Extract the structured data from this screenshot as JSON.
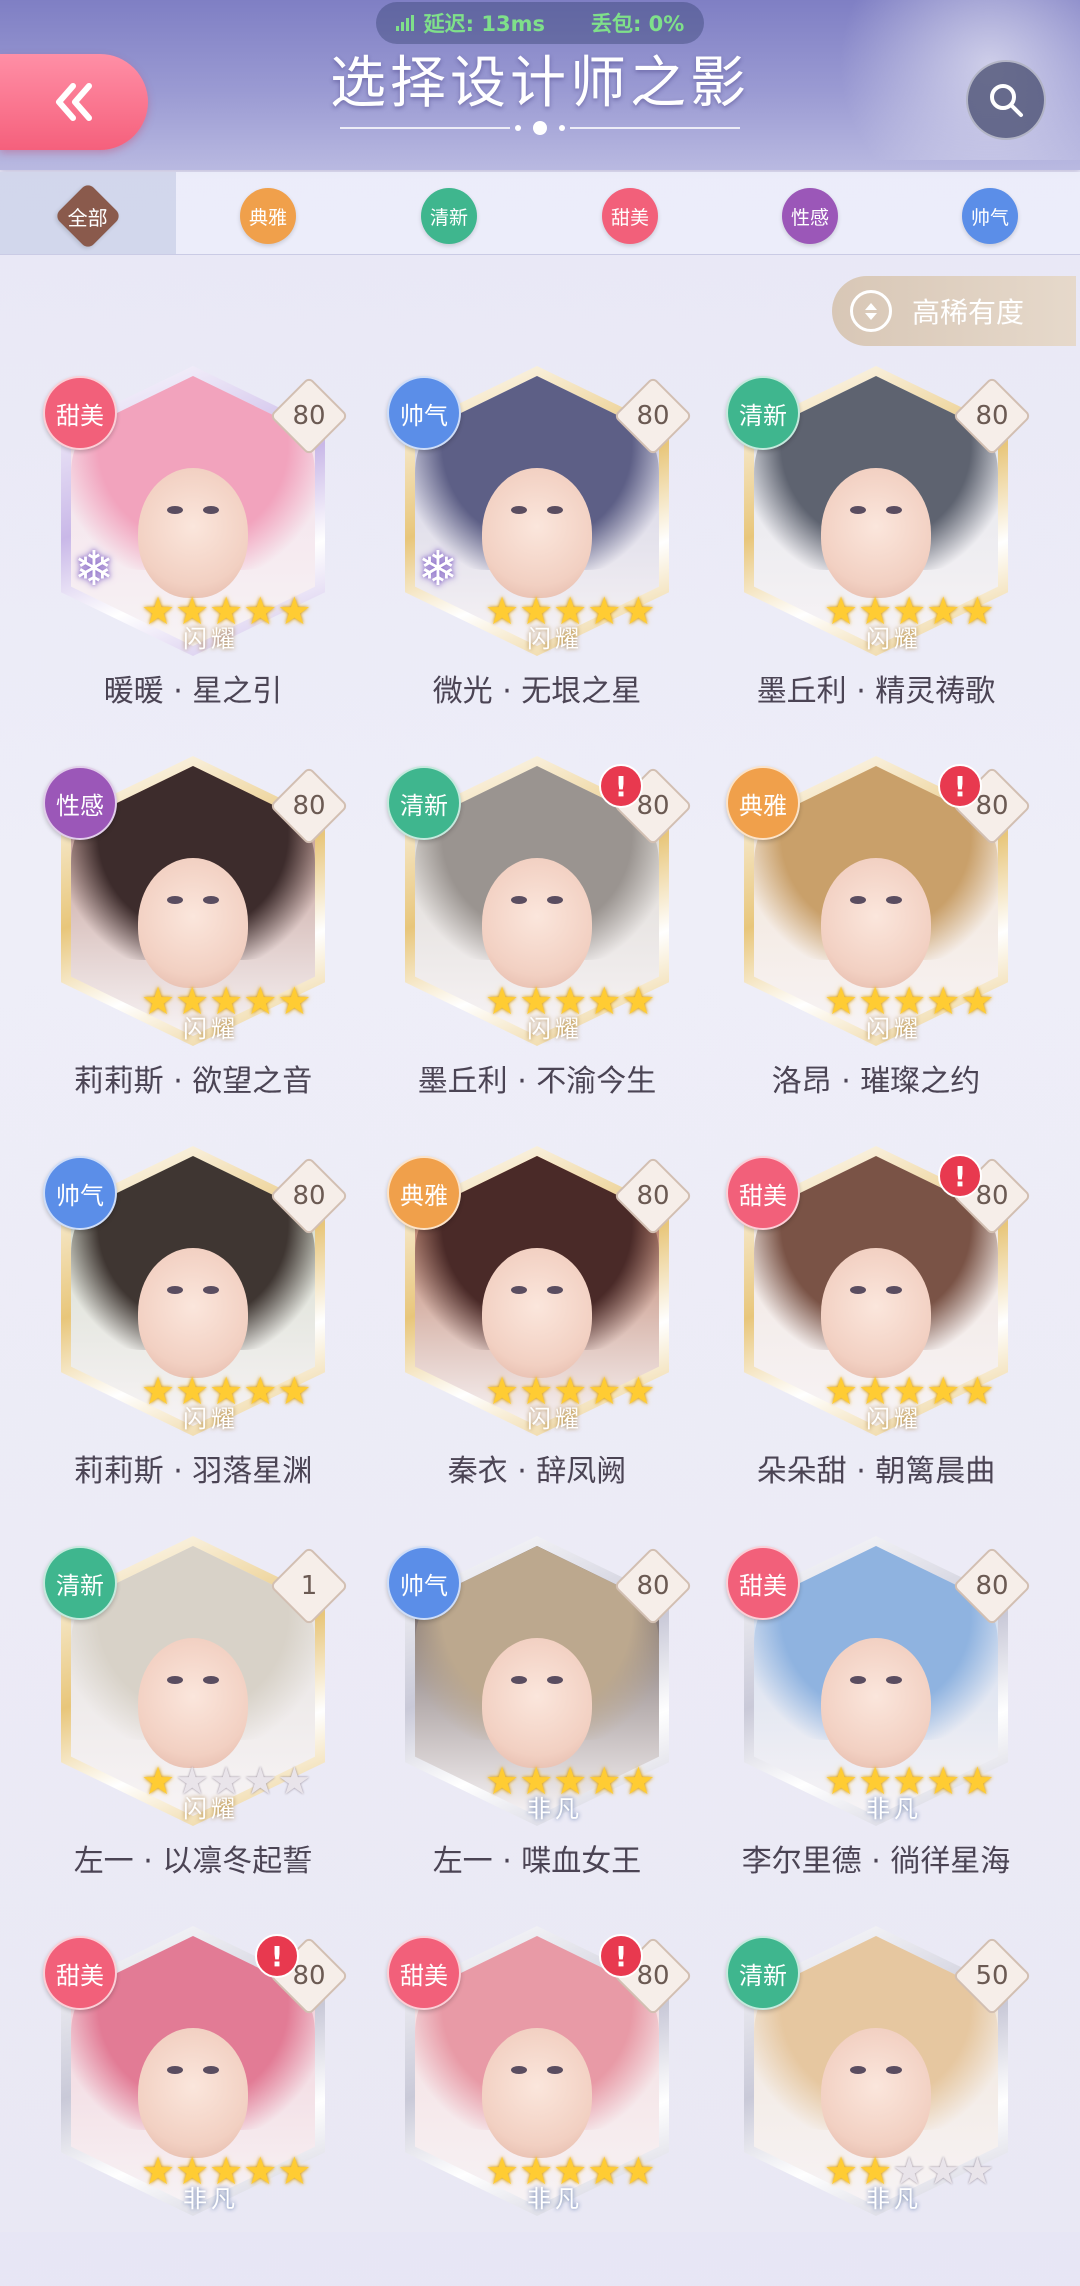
{
  "status_bar": {
    "latency": "延迟: 13ms",
    "packet_loss": "丢包: 0%"
  },
  "header": {
    "title": "选择设计师之影"
  },
  "filters": [
    {
      "label": "全部",
      "color": "#8a5a4c",
      "selected": true
    },
    {
      "label": "典雅",
      "color": "#f0a04b"
    },
    {
      "label": "清新",
      "color": "#3fb68e"
    },
    {
      "label": "甜美",
      "color": "#f2607a"
    },
    {
      "label": "性感",
      "color": "#9b57b8"
    },
    {
      "label": "帅气",
      "color": "#5b8ee8"
    }
  ],
  "sort": {
    "label": "高稀有度"
  },
  "cards": [
    {
      "name": "暖暖 · 星之引",
      "tag": "甜美",
      "tag_color": "#f2607a",
      "level": "80",
      "stars": 5,
      "rarity": "闪耀",
      "frame": "#c9b8e8",
      "hair": "#f2a3bd",
      "bg": "#f3dbe7",
      "snowflake": true,
      "alert": false
    },
    {
      "name": "微光 · 无垠之星",
      "tag": "帅气",
      "tag_color": "#5b8ee8",
      "level": "80",
      "stars": 5,
      "rarity": "闪耀",
      "frame": "#e8c67a",
      "hair": "#5d5f86",
      "bg": "#c8c9df",
      "snowflake": true,
      "alert": false
    },
    {
      "name": "墨丘利 · 精灵祷歌",
      "tag": "清新",
      "tag_color": "#3fb68e",
      "level": "80",
      "stars": 5,
      "rarity": "闪耀",
      "frame": "#e8c67a",
      "hair": "#5e6370",
      "bg": "#dfe3ea",
      "snowflake": false,
      "alert": false
    },
    {
      "name": "莉莉斯 · 欲望之音",
      "tag": "性感",
      "tag_color": "#9b57b8",
      "level": "80",
      "stars": 5,
      "rarity": "闪耀",
      "frame": "#e8c67a",
      "hair": "#3d2c2c",
      "bg": "#b88a80",
      "snowflake": false,
      "alert": false
    },
    {
      "name": "墨丘利 · 不渝今生",
      "tag": "清新",
      "tag_color": "#3fb68e",
      "level": "80",
      "stars": 5,
      "rarity": "闪耀",
      "frame": "#e8c67a",
      "hair": "#9a9490",
      "bg": "#d6d3cc",
      "snowflake": false,
      "alert": true
    },
    {
      "name": "洛昂 · 璀璨之约",
      "tag": "典雅",
      "tag_color": "#f0a04b",
      "level": "80",
      "stars": 5,
      "rarity": "闪耀",
      "frame": "#e8c67a",
      "hair": "#c9a06a",
      "bg": "#f1e2cf",
      "snowflake": false,
      "alert": true
    },
    {
      "name": "莉莉斯 · 羽落星渊",
      "tag": "帅气",
      "tag_color": "#5b8ee8",
      "level": "80",
      "stars": 5,
      "rarity": "闪耀",
      "frame": "#e8c67a",
      "hair": "#3f3632",
      "bg": "#cfd8c6",
      "snowflake": false,
      "alert": false
    },
    {
      "name": "秦衣 · 辞凤阙",
      "tag": "典雅",
      "tag_color": "#f0a04b",
      "level": "80",
      "stars": 5,
      "rarity": "闪耀",
      "frame": "#e8c67a",
      "hair": "#4a2a28",
      "bg": "#b0664a",
      "snowflake": false,
      "alert": false
    },
    {
      "name": "朵朵甜 · 朝篱晨曲",
      "tag": "甜美",
      "tag_color": "#f2607a",
      "level": "80",
      "stars": 5,
      "rarity": "闪耀",
      "frame": "#e8c67a",
      "hair": "#7a5346",
      "bg": "#efe4dc",
      "snowflake": false,
      "alert": true
    },
    {
      "name": "左一 · 以凛冬起誓",
      "tag": "清新",
      "tag_color": "#3fb68e",
      "level": "1",
      "stars": 1,
      "rarity": "闪耀",
      "frame": "#e8c67a",
      "hair": "#d8d2c8",
      "bg": "#e3e0dc",
      "snowflake": false,
      "alert": false
    },
    {
      "name": "左一 · 喋血女王",
      "tag": "帅气",
      "tag_color": "#5b8ee8",
      "level": "80",
      "stars": 5,
      "rarity": "非凡",
      "frame": "#c9c9d8",
      "hair": "#bca88e",
      "bg": "#5a4b48",
      "snowflake": false,
      "alert": false
    },
    {
      "name": "李尔里德 · 徜徉星海",
      "tag": "甜美",
      "tag_color": "#f2607a",
      "level": "80",
      "stars": 5,
      "rarity": "非凡",
      "frame": "#c9c9d8",
      "hair": "#8fb3e0",
      "bg": "#c9d8ee",
      "snowflake": false,
      "alert": false
    },
    {
      "name": "",
      "tag": "甜美",
      "tag_color": "#f2607a",
      "level": "80",
      "stars": 5,
      "rarity": "非凡",
      "frame": "#c9c9d8",
      "hair": "#e27b95",
      "bg": "#f0c9d4",
      "snowflake": false,
      "alert": true
    },
    {
      "name": "",
      "tag": "甜美",
      "tag_color": "#f2607a",
      "level": "80",
      "stars": 5,
      "rarity": "非凡",
      "frame": "#c9c9d8",
      "hair": "#e89aa6",
      "bg": "#f3d8db",
      "snowflake": false,
      "alert": true
    },
    {
      "name": "",
      "tag": "清新",
      "tag_color": "#3fb68e",
      "level": "50",
      "stars": 2,
      "rarity": "非凡",
      "frame": "#c9c9d8",
      "hair": "#e6c7a0",
      "bg": "#efe4d6",
      "snowflake": false,
      "alert": false
    }
  ]
}
